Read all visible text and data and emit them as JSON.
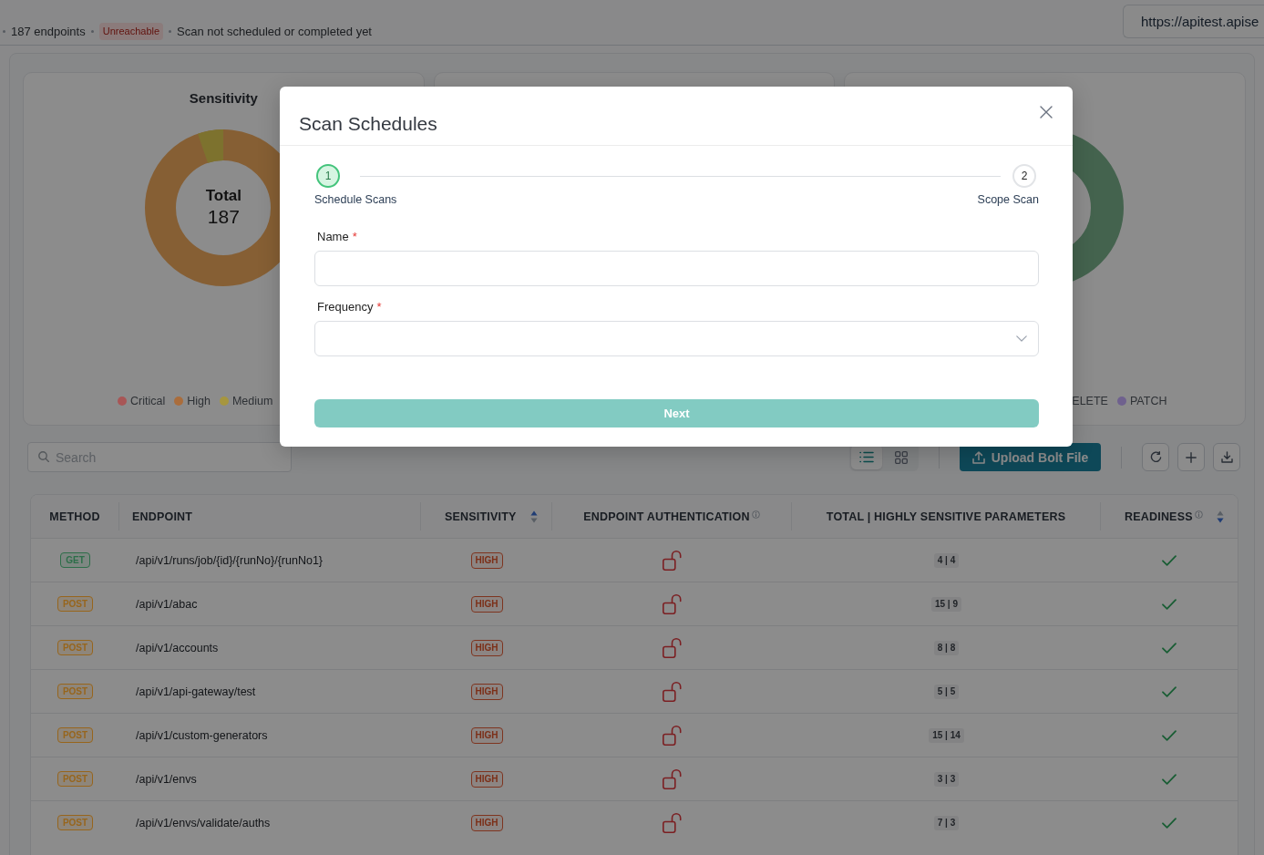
{
  "header": {
    "endpoint_count": "187 endpoints",
    "status_badge": "Unreachable",
    "scan_status": "Scan not scheduled or completed yet",
    "url": "https://apitest.apise"
  },
  "sensitivity_card": {
    "title": "Sensitivity",
    "center_label": "Total",
    "center_value": "187",
    "legend": [
      {
        "label": "Critical",
        "color": "#a85656"
      },
      {
        "label": "High",
        "color": "#aa6d3c"
      },
      {
        "label": "Medium",
        "color": "#a6963f"
      }
    ]
  },
  "method_card": {
    "legend": [
      {
        "label": "ELETE"
      },
      {
        "label": "PATCH",
        "color": "#6f618e"
      }
    ]
  },
  "toolbar": {
    "search": {
      "placeholder": "Search"
    },
    "views": [
      {
        "kind": "list",
        "selected": true
      },
      {
        "kind": "grid",
        "selected": false
      }
    ],
    "upload_button": "Upload Bolt File",
    "actions": [
      {
        "kind": "refresh"
      },
      {
        "kind": "add"
      },
      {
        "kind": "download"
      }
    ]
  },
  "table": {
    "columns": [
      {
        "label": "METHOD",
        "info": false
      },
      {
        "label": "ENDPOINT",
        "info": false
      },
      {
        "label": "SENSITIVITY",
        "info": false,
        "sort": {
          "descending": false
        }
      },
      {
        "label": "ENDPOINT AUTHENTICATION",
        "info": true
      },
      {
        "label": "TOTAL | HIGHLY SENSITIVE PARAMETERS",
        "info": false
      },
      {
        "label": "READINESS",
        "info": true,
        "sort": {
          "descending": true
        }
      }
    ],
    "rows": [
      {
        "method": {
          "label": "GET",
          "color": "#2d6e49"
        },
        "endpoint": "/api/v1/runs/job/{id}/{runNo}/{runNo1}",
        "sensitivity": "HIGH",
        "authenticated": false,
        "parameters": "4 | 4",
        "ready": true
      },
      {
        "method": {
          "label": "POST",
          "color": "#97651c"
        },
        "endpoint": "/api/v1/abac",
        "sensitivity": "HIGH",
        "authenticated": false,
        "parameters": "15 | 9",
        "ready": true
      },
      {
        "method": {
          "label": "POST",
          "color": "#97651c"
        },
        "endpoint": "/api/v1/accounts",
        "sensitivity": "HIGH",
        "authenticated": false,
        "parameters": "8 | 8",
        "ready": true
      },
      {
        "method": {
          "label": "POST",
          "color": "#97651c"
        },
        "endpoint": "/api/v1/api-gateway/test",
        "sensitivity": "HIGH",
        "authenticated": false,
        "parameters": "5 | 5",
        "ready": true
      },
      {
        "method": {
          "label": "POST",
          "color": "#97651c"
        },
        "endpoint": "/api/v1/custom-generators",
        "sensitivity": "HIGH",
        "authenticated": false,
        "parameters": "15 | 14",
        "ready": true
      },
      {
        "method": {
          "label": "POST",
          "color": "#97651c"
        },
        "endpoint": "/api/v1/envs",
        "sensitivity": "HIGH",
        "authenticated": false,
        "parameters": "3 | 3",
        "ready": true
      },
      {
        "method": {
          "label": "POST",
          "color": "#97651c"
        },
        "endpoint": "/api/v1/envs/validate/auths",
        "sensitivity": "HIGH",
        "authenticated": false,
        "parameters": "7 | 3",
        "ready": true
      }
    ]
  },
  "modal": {
    "title": "Scan Schedules",
    "steps": [
      {
        "number": "1",
        "label": "Schedule Scans",
        "selected": true
      },
      {
        "number": "2",
        "label": "Scope Scan",
        "selected": false
      }
    ],
    "fields": [
      {
        "kind": "text",
        "label": "Name",
        "required_mark": "*"
      },
      {
        "kind": "select",
        "label": "Frequency",
        "required_mark": "*"
      }
    ],
    "next_button": {
      "label": "Next",
      "disabled": true
    }
  }
}
